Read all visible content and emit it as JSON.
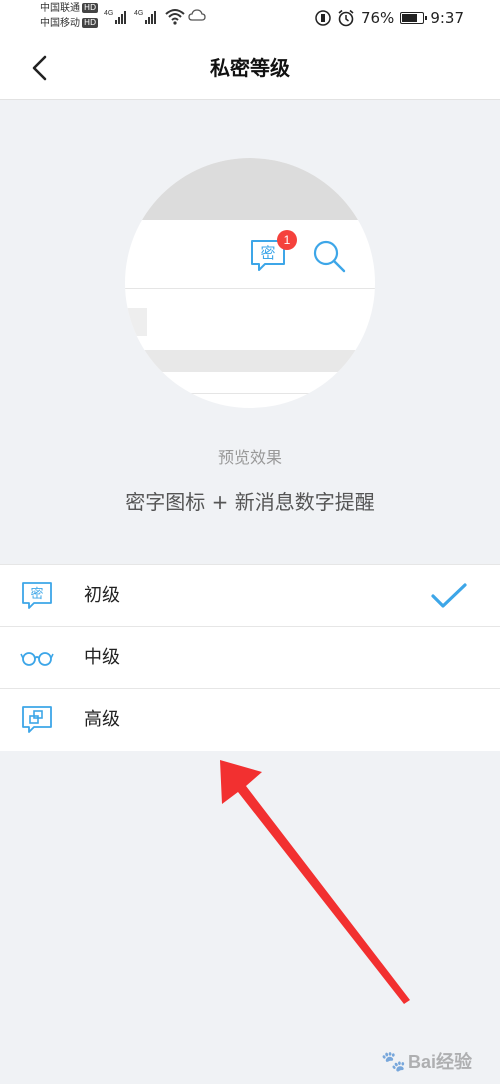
{
  "status_bar": {
    "carrier1": "中国联通",
    "carrier2": "中国移动",
    "hd": "HD",
    "net": "4G",
    "battery_text": "76%",
    "battery_level": 0.76,
    "time": "9:37"
  },
  "navbar": {
    "title": "私密等级"
  },
  "preview": {
    "icon_char": "密",
    "badge_count": "1",
    "label": "预览效果",
    "description": "密字图标 + 新消息数字提醒"
  },
  "options": [
    {
      "label": "初级",
      "icon": "mi-bubble-icon",
      "selected": true
    },
    {
      "label": "中级",
      "icon": "glasses-icon",
      "selected": false
    },
    {
      "label": "高级",
      "icon": "squares-bubble-icon",
      "selected": false
    }
  ],
  "colors": {
    "accent_blue": "#3da6e8",
    "badge_red": "#f5423c",
    "annotation_red": "#f23030",
    "background": "#f0f2f5"
  },
  "watermark": {
    "text": "Bai经验"
  }
}
